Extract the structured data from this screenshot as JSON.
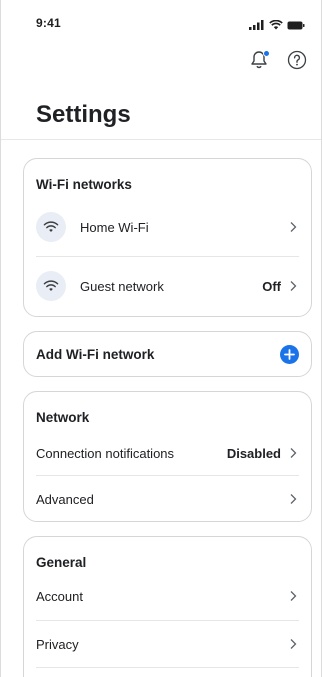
{
  "status_bar": {
    "time": "9:41"
  },
  "header": {
    "title": "Settings"
  },
  "top_actions": {
    "notifications_icon": "bell-with-badge-icon",
    "help_icon": "help-circle-icon"
  },
  "wifi_card": {
    "title": "Wi-Fi networks",
    "items": [
      {
        "label": "Home Wi-Fi",
        "value": "",
        "icon": "wifi-icon"
      },
      {
        "label": "Guest network",
        "value": "Off",
        "icon": "wifi-icon"
      }
    ]
  },
  "add_wifi_card": {
    "label": "Add Wi-Fi network",
    "icon": "plus-circle-icon"
  },
  "network_card": {
    "title": "Network",
    "items": [
      {
        "label": "Connection notifications",
        "value": "Disabled"
      },
      {
        "label": "Advanced",
        "value": ""
      }
    ]
  },
  "general_card": {
    "title": "General",
    "items": [
      {
        "label": "Account",
        "value": ""
      },
      {
        "label": "Privacy",
        "value": ""
      }
    ]
  },
  "colors": {
    "accent": "#1a73e8",
    "icon_bg": "#e9eef6",
    "border": "#d6d6d6"
  }
}
